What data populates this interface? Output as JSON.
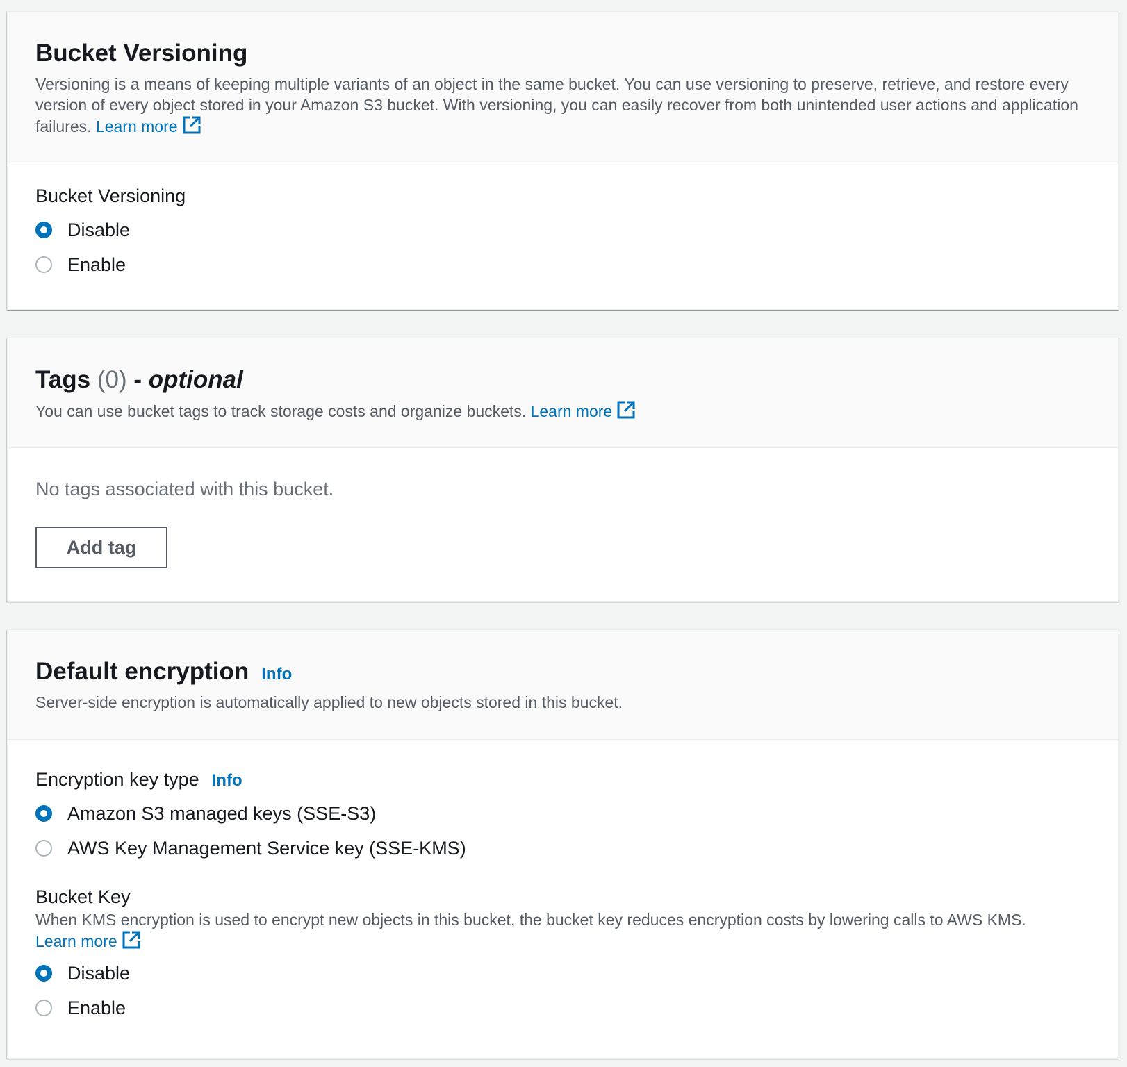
{
  "versioning": {
    "title": "Bucket Versioning",
    "description": "Versioning is a means of keeping multiple variants of an object in the same bucket. You can use versioning to preserve, retrieve, and restore every version of every object stored in your Amazon S3 bucket. With versioning, you can easily recover from both unintended user actions and application failures.",
    "learn_more": "Learn more",
    "field_label": "Bucket Versioning",
    "options": [
      "Disable",
      "Enable"
    ],
    "selected": "Disable"
  },
  "tags": {
    "title": "Tags",
    "count": "(0)",
    "separator": "-",
    "optional": "optional",
    "description": "You can use bucket tags to track storage costs and organize buckets.",
    "learn_more": "Learn more",
    "empty_text": "No tags associated with this bucket.",
    "add_button": "Add tag"
  },
  "encryption": {
    "title": "Default encryption",
    "info": "Info",
    "description": "Server-side encryption is automatically applied to new objects stored in this bucket.",
    "key_type_label": "Encryption key type",
    "key_type_info": "Info",
    "key_type_options": [
      "Amazon S3 managed keys (SSE-S3)",
      "AWS Key Management Service key (SSE-KMS)"
    ],
    "key_type_selected": "Amazon S3 managed keys (SSE-S3)",
    "bucket_key_label": "Bucket Key",
    "bucket_key_description": "When KMS encryption is used to encrypt new objects in this bucket, the bucket key reduces encryption costs by lowering calls to AWS KMS.",
    "learn_more": "Learn more",
    "bucket_key_options": [
      "Disable",
      "Enable"
    ],
    "bucket_key_selected": "Disable"
  },
  "colors": {
    "link": "#0073bb",
    "background": "#f2f3f3",
    "text": "#16191f",
    "muted": "#687078"
  }
}
